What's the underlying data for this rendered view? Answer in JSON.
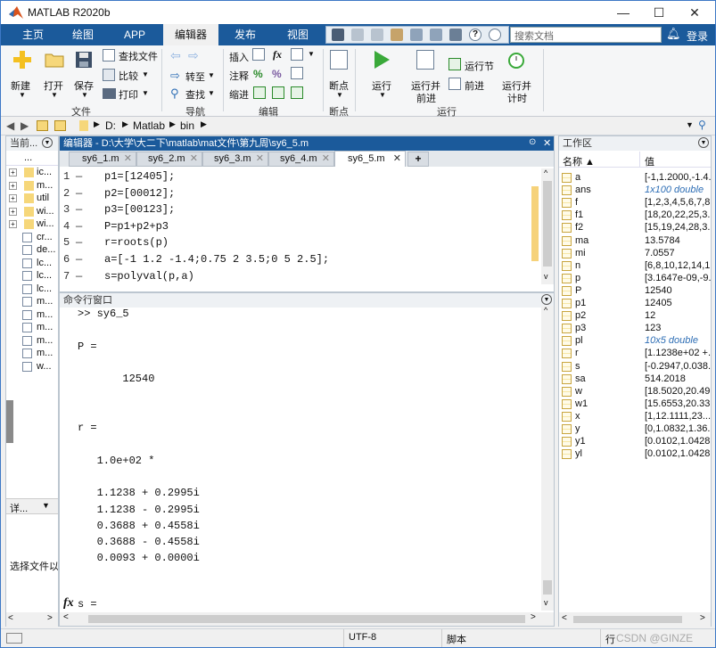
{
  "window": {
    "title": "MATLAB R2020b",
    "min": "—",
    "max": "☐",
    "close": "✕"
  },
  "tabs": [
    "主页",
    "绘图",
    "APP",
    "编辑器",
    "发布",
    "视图"
  ],
  "search": {
    "placeholder": "搜索文档"
  },
  "login": "登录",
  "ribbon": {
    "new": "新建",
    "open": "打开",
    "save": "保存",
    "find_files": "查找文件",
    "compare": "比较",
    "print": "打印",
    "goto": "转至",
    "find": "查找",
    "insert": "插入",
    "comment": "注释",
    "indent": "缩进",
    "breakpoint": "断点",
    "run": "运行",
    "run_advance_1": "运行并",
    "run_advance_2": "前进",
    "run_section": "运行节",
    "advance": "前进",
    "run_time_1": "运行并",
    "run_time_2": "计时",
    "groups": {
      "file": "文件",
      "nav": "导航",
      "edit": "编辑",
      "bp": "断点",
      "run": "运行"
    }
  },
  "address": {
    "parts": [
      "D:",
      "Matlab",
      "bin"
    ]
  },
  "left": {
    "title": "当前...",
    "header": "...",
    "items": [
      "ic...",
      "m...",
      "util",
      "wi...",
      "wi...",
      "cr...",
      "de...",
      "lc...",
      "lc...",
      "lc...",
      "m...",
      "m...",
      "m...",
      "m...",
      "m...",
      "w..."
    ],
    "detail": "详...",
    "select_hint": "选择文件以"
  },
  "editor": {
    "title": "编辑器 - D:\\大学\\大二下\\matlab\\mat文件\\第九周\\sy6_5.m",
    "tabs": [
      "sy6_1.m",
      "sy6_2.m",
      "sy6_3.m",
      "sy6_4.m",
      "sy6_5.m"
    ],
    "add_tab": "+",
    "lines": [
      {
        "n": "1",
        "code": "p1=[12405];"
      },
      {
        "n": "2",
        "code": "p2=[00012];"
      },
      {
        "n": "3",
        "code": "p3=[00123];"
      },
      {
        "n": "4",
        "code": "P=p1+p2+p3"
      },
      {
        "n": "5",
        "code": "r=roots(p)"
      },
      {
        "n": "6",
        "code": "a=[-1 1.2 -1.4;0.75 2 3.5;0 5 2.5];"
      },
      {
        "n": "7",
        "code": "s=polyval(p,a)"
      },
      {
        "n": "8",
        "code": ""
      }
    ]
  },
  "command": {
    "title": "命令行窗口",
    "lines": [
      ">> sy6_5",
      "",
      "P =",
      "",
      "       12540",
      "",
      "",
      "r =",
      "",
      "   1.0e+02 *",
      "",
      "   1.1238 + 0.2995i",
      "   1.1238 - 0.2995i",
      "   0.3688 + 0.4558i",
      "   0.3688 - 0.4558i",
      "   0.0093 + 0.0000i"
    ],
    "prompt_fx": "fx",
    "last_line": "s ="
  },
  "workspace": {
    "title": "工作区",
    "col_name": "名称 ▲",
    "col_value": "值",
    "vars": [
      {
        "name": "a",
        "value": "[-1,1.2000,-1.4..."
      },
      {
        "name": "ans",
        "value": "1x100 double",
        "italic": true
      },
      {
        "name": "f",
        "value": "[1,2,3,4,5,6,7,8..."
      },
      {
        "name": "f1",
        "value": "[18,20,22,25,3..."
      },
      {
        "name": "f2",
        "value": "[15,19,24,28,3..."
      },
      {
        "name": "ma",
        "value": "13.5784"
      },
      {
        "name": "mi",
        "value": "7.0557"
      },
      {
        "name": "n",
        "value": "[6,8,10,12,14,1..."
      },
      {
        "name": "p",
        "value": "[3.1647e-09,-9..."
      },
      {
        "name": "P",
        "value": "12540"
      },
      {
        "name": "p1",
        "value": "12405"
      },
      {
        "name": "p2",
        "value": "12"
      },
      {
        "name": "p3",
        "value": "123"
      },
      {
        "name": "pl",
        "value": "10x5 double",
        "italic": true
      },
      {
        "name": "r",
        "value": "[1.1238e+02 +..."
      },
      {
        "name": "s",
        "value": "[-0.2947,0.038..."
      },
      {
        "name": "sa",
        "value": "514.2018"
      },
      {
        "name": "w",
        "value": "[18.5020,20.49..."
      },
      {
        "name": "w1",
        "value": "[15.6553,20.33..."
      },
      {
        "name": "x",
        "value": "[1,12.1111,23..."
      },
      {
        "name": "y",
        "value": "[0,1.0832,1.36..."
      },
      {
        "name": "y1",
        "value": "[0.0102,1.0428..."
      },
      {
        "name": "yl",
        "value": "[0.0102,1.0428..."
      }
    ]
  },
  "status": {
    "encoding": "UTF-8",
    "type": "脚本",
    "row": "行",
    "watermark": "CSDN @GINZE"
  }
}
